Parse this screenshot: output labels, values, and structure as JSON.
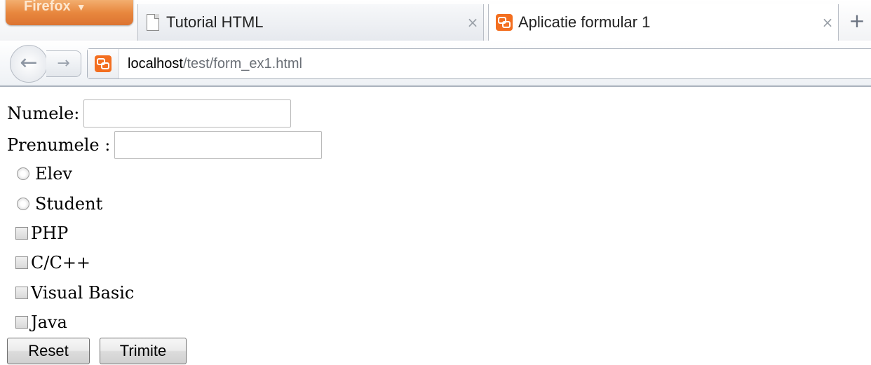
{
  "browser": {
    "menu_button": "Firefox",
    "tabs": [
      {
        "title": "Tutorial HTML",
        "close": "×"
      },
      {
        "title": "Aplicatie formular 1",
        "close": "×"
      }
    ],
    "new_tab": "+",
    "back": "←",
    "forward": "→",
    "url": {
      "host": "localhost",
      "path": "/test/form_ex1.html"
    }
  },
  "form": {
    "fields": [
      {
        "label": "Numele:",
        "value": ""
      },
      {
        "label": "Prenumele :",
        "value": ""
      }
    ],
    "radios": [
      {
        "label": "Elev",
        "checked": false
      },
      {
        "label": "Student",
        "checked": false
      }
    ],
    "checkboxes": [
      {
        "label": "PHP",
        "checked": false
      },
      {
        "label": "C/C++",
        "checked": false
      },
      {
        "label": "Visual Basic",
        "checked": false
      },
      {
        "label": "Java",
        "checked": false
      }
    ],
    "buttons": {
      "reset": "Reset",
      "submit": "Trimite"
    }
  },
  "colors": {
    "firefox_orange": "#e5731d",
    "url_path_gray": "#6a6f76"
  }
}
